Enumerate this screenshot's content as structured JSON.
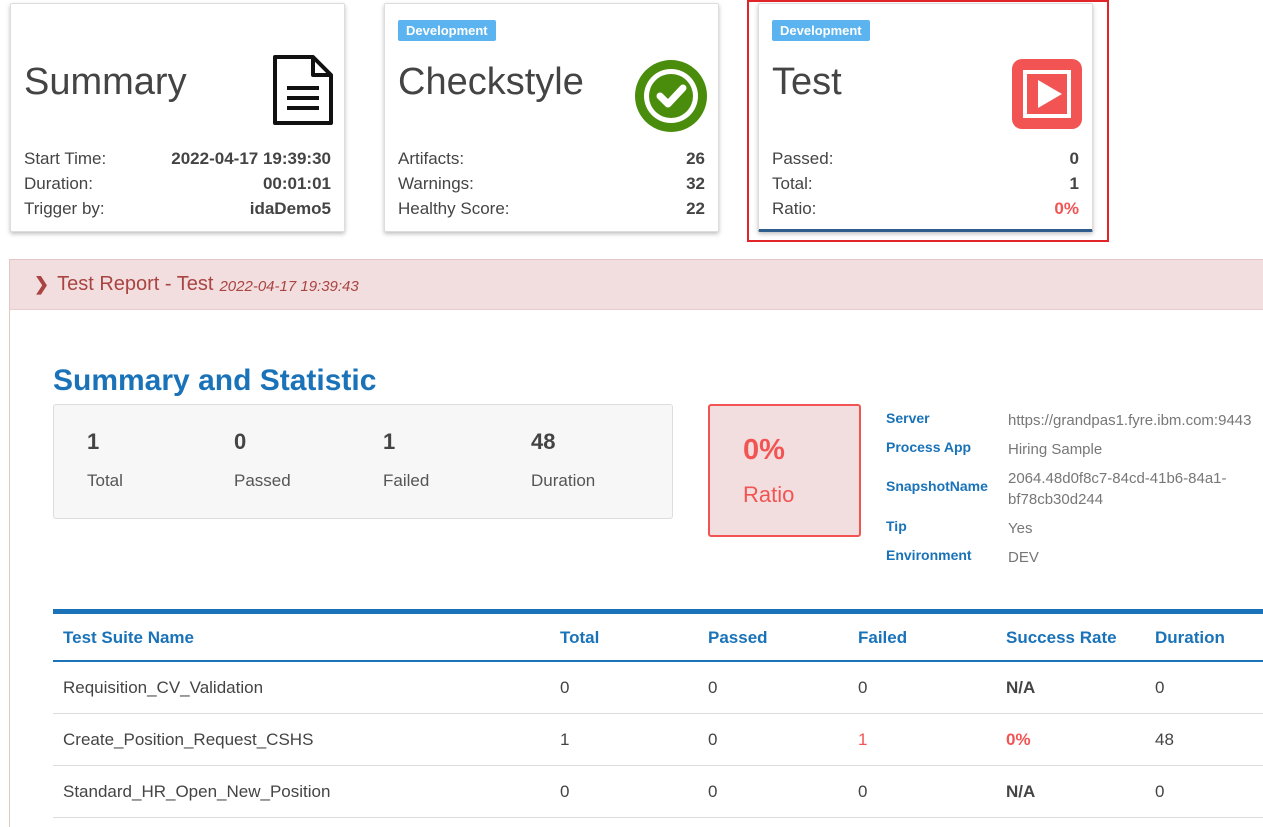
{
  "cards": {
    "summary": {
      "title": "Summary",
      "icon": "document-icon",
      "rows": [
        {
          "label": "Start Time:",
          "value": "2022-04-17 19:39:30"
        },
        {
          "label": "Duration:",
          "value": "00:01:01"
        },
        {
          "label": "Trigger by:",
          "value": "idaDemo5"
        }
      ]
    },
    "checkstyle": {
      "badge": "Development",
      "title": "Checkstyle",
      "icon": "check-circle-icon",
      "rows": [
        {
          "label": "Artifacts:",
          "value": "26"
        },
        {
          "label": "Warnings:",
          "value": "32"
        },
        {
          "label": "Healthy Score:",
          "value": "22"
        }
      ]
    },
    "test": {
      "badge": "Development",
      "title": "Test",
      "icon": "play-icon",
      "rows": [
        {
          "label": "Passed:",
          "value": "0"
        },
        {
          "label": "Total:",
          "value": "1"
        },
        {
          "label": "Ratio:",
          "value": "0%"
        }
      ]
    }
  },
  "report": {
    "title": "Test Report - Test",
    "date": "2022-04-17 19:39:43",
    "section_title": "Summary and Statistic",
    "stats": [
      {
        "value": "1",
        "label": "Total"
      },
      {
        "value": "0",
        "label": "Passed"
      },
      {
        "value": "1",
        "label": "Failed"
      },
      {
        "value": "48",
        "label": "Duration"
      }
    ],
    "ratio": {
      "value": "0%",
      "label": "Ratio"
    },
    "meta": [
      {
        "key": "Server",
        "value": "https://grandpas1.fyre.ibm.com:9443"
      },
      {
        "key": "Process App",
        "value": "Hiring Sample"
      },
      {
        "key": "SnapshotName",
        "value": "2064.48d0f8c7-84cd-41b6-84a1-bf78cb30d244"
      },
      {
        "key": "Tip",
        "value": "Yes"
      },
      {
        "key": "Environment",
        "value": "DEV"
      }
    ],
    "table": {
      "headers": [
        "Test Suite Name",
        "Total",
        "Passed",
        "Failed",
        "Success Rate",
        "Duration"
      ],
      "rows": [
        [
          "Requisition_CV_Validation",
          "0",
          "0",
          "0",
          "N/A",
          "0"
        ],
        [
          "Create_Position_Request_CSHS",
          "1",
          "0",
          "1",
          "0%",
          "48"
        ],
        [
          "Standard_HR_Open_New_Position",
          "0",
          "0",
          "0",
          "N/A",
          "0"
        ]
      ]
    }
  },
  "colors": {
    "accent": "#1a73b8",
    "danger": "#f25454",
    "badge": "#5bb4f0",
    "success": "#4a8c0c"
  }
}
